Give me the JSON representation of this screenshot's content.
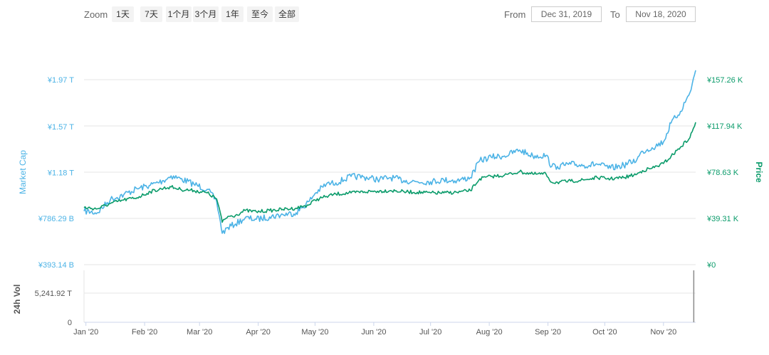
{
  "toolbar": {
    "zoom_label": "Zoom",
    "zoom_buttons": [
      "1天",
      "7天",
      "1个月",
      "3个月",
      "1年",
      "至今",
      "全部"
    ],
    "from_label": "From",
    "from_value": "Dec 31, 2019",
    "to_label": "To",
    "to_value": "Nov 18, 2020"
  },
  "colors": {
    "market_cap": "#4cb3e6",
    "price": "#0a9b6a",
    "grid": "#e6e6e6",
    "volume": "#8c8c8c"
  },
  "chart_data": {
    "type": "line",
    "x_range": [
      "Dec 31, 2019",
      "Nov 18, 2020"
    ],
    "x_ticks": [
      "Jan '20",
      "Feb '20",
      "Mar '20",
      "Apr '20",
      "May '20",
      "Jun '20",
      "Jul '20",
      "Aug '20",
      "Sep '20",
      "Oct '20",
      "Nov '20"
    ],
    "left_axis": {
      "title": "Market Cap",
      "ticks": [
        "¥393.14 B",
        "¥786.29 B",
        "¥1.18 T",
        "¥1.57 T",
        "¥1.97 T"
      ],
      "values": [
        393.14,
        786.29,
        1180,
        1570,
        1970
      ],
      "unit": "¥ B"
    },
    "right_axis": {
      "title": "Price",
      "ticks": [
        "¥0",
        "¥39.31 K",
        "¥78.63 K",
        "¥117.94 K",
        "¥157.26 K"
      ],
      "values": [
        0,
        39310,
        78630,
        117940,
        157260
      ],
      "unit": "¥"
    },
    "volume_axis": {
      "title": "24h Vol",
      "ticks": [
        "0",
        "5,241.92 T"
      ],
      "values": [
        0,
        5241.92
      ]
    },
    "series": [
      {
        "name": "Market Cap",
        "axis": "left",
        "x": [
          "2019-12-31",
          "2020-01-07",
          "2020-01-14",
          "2020-01-21",
          "2020-01-28",
          "2020-02-04",
          "2020-02-11",
          "2020-02-15",
          "2020-02-20",
          "2020-02-27",
          "2020-03-05",
          "2020-03-10",
          "2020-03-12",
          "2020-03-13",
          "2020-03-16",
          "2020-03-20",
          "2020-03-25",
          "2020-03-31",
          "2020-04-07",
          "2020-04-14",
          "2020-04-21",
          "2020-04-28",
          "2020-05-01",
          "2020-05-07",
          "2020-05-12",
          "2020-05-20",
          "2020-05-27",
          "2020-06-03",
          "2020-06-10",
          "2020-06-17",
          "2020-06-24",
          "2020-07-01",
          "2020-07-08",
          "2020-07-15",
          "2020-07-22",
          "2020-07-27",
          "2020-08-02",
          "2020-08-09",
          "2020-08-17",
          "2020-08-24",
          "2020-08-31",
          "2020-09-03",
          "2020-09-06",
          "2020-09-13",
          "2020-09-20",
          "2020-09-27",
          "2020-10-04",
          "2020-10-11",
          "2020-10-18",
          "2020-10-21",
          "2020-10-26",
          "2020-11-01",
          "2020-11-05",
          "2020-11-10",
          "2020-11-15",
          "2020-11-18"
        ],
        "values": [
          850,
          835,
          950,
          990,
          1040,
          1070,
          1110,
          1150,
          1125,
          1080,
          1035,
          935,
          760,
          660,
          710,
          740,
          790,
          780,
          800,
          820,
          835,
          935,
          1000,
          1080,
          1090,
          1145,
          1140,
          1120,
          1135,
          1110,
          1100,
          1100,
          1115,
          1110,
          1135,
          1280,
          1310,
          1320,
          1370,
          1320,
          1325,
          1230,
          1230,
          1250,
          1240,
          1250,
          1215,
          1240,
          1290,
          1360,
          1390,
          1440,
          1600,
          1700,
          1860,
          2050
        ]
      },
      {
        "name": "Price",
        "axis": "right",
        "x": [
          "2019-12-31",
          "2020-01-07",
          "2020-01-14",
          "2020-01-21",
          "2020-01-28",
          "2020-02-04",
          "2020-02-11",
          "2020-02-15",
          "2020-02-20",
          "2020-02-27",
          "2020-03-05",
          "2020-03-10",
          "2020-03-12",
          "2020-03-13",
          "2020-03-16",
          "2020-03-20",
          "2020-03-25",
          "2020-03-31",
          "2020-04-07",
          "2020-04-14",
          "2020-04-21",
          "2020-04-28",
          "2020-05-01",
          "2020-05-07",
          "2020-05-12",
          "2020-05-20",
          "2020-05-27",
          "2020-06-03",
          "2020-06-10",
          "2020-06-17",
          "2020-06-24",
          "2020-07-01",
          "2020-07-08",
          "2020-07-15",
          "2020-07-22",
          "2020-07-27",
          "2020-08-02",
          "2020-08-09",
          "2020-08-17",
          "2020-08-24",
          "2020-08-31",
          "2020-09-03",
          "2020-09-06",
          "2020-09-13",
          "2020-09-20",
          "2020-09-27",
          "2020-10-04",
          "2020-10-11",
          "2020-10-18",
          "2020-10-21",
          "2020-10-26",
          "2020-11-01",
          "2020-11-05",
          "2020-11-10",
          "2020-11-15",
          "2020-11-18"
        ],
        "values": [
          48500,
          47500,
          52000,
          55000,
          57000,
          62000,
          65000,
          66000,
          64000,
          63000,
          61000,
          56000,
          44000,
          36000,
          41000,
          42000,
          46000,
          45000,
          46000,
          47000,
          48000,
          51000,
          55000,
          58000,
          60000,
          61000,
          62000,
          62500,
          63000,
          62000,
          61500,
          61000,
          61000,
          61500,
          63000,
          73000,
          75000,
          76000,
          79000,
          77000,
          77000,
          70000,
          70000,
          71000,
          72000,
          74000,
          73000,
          74000,
          77000,
          80000,
          82000,
          86000,
          92000,
          100000,
          108000,
          121000
        ]
      },
      {
        "name": "24h Vol",
        "axis": "volume",
        "x": [
          "2019-12-31",
          "2020-11-15",
          "2020-11-16",
          "2020-11-17",
          "2020-11-18"
        ],
        "values": [
          0,
          0,
          0,
          5241.92,
          0
        ]
      }
    ],
    "grid": true,
    "legend": "none"
  }
}
